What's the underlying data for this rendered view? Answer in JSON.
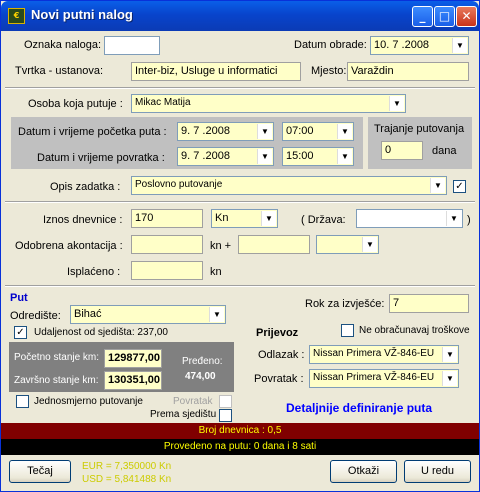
{
  "window": {
    "title": "Novi putni nalog",
    "icon_text": "€"
  },
  "labels": {
    "oznaka": "Oznaka naloga:",
    "datum_obrade": "Datum obrade:",
    "tvrtka": "Tvrtka - ustanova:",
    "mjesto": "Mjesto:",
    "osoba": "Osoba koja putuje :",
    "pocetak": "Datum i vrijeme početka puta :",
    "povratak": "Datum i vrijeme povratka :",
    "trajanje": "Trajanje putovanja",
    "dana": "dana",
    "opis": "Opis zadatka :",
    "iznos": "Iznos dnevnice :",
    "drzava_open": "( Država:",
    "drzava_close": ")",
    "akontacija": "Odobrena akontacija :",
    "kn_plus": "kn +",
    "isplaceno": "Isplaćeno :",
    "kn": "kn",
    "put": "Put",
    "odrediste": "Odredište:",
    "rok": "Rok za izvješće:",
    "udaljenost": "Udaljenost od sjedišta: 237,00",
    "pocetno_stanje": "Početno stanje km:",
    "zavrsno_stanje": "Završno stanje km:",
    "predjeno": "Pređeno:",
    "jednosmjerno": "Jednosmjerno putovanje",
    "povratak_chk": "Povratak",
    "prema_sjedistu": "Prema sjedištu",
    "prijevoz": "Prijevoz",
    "ne_obracunavaj": "Ne obračunavaj troškove",
    "odlazak": "Odlazak :",
    "povratak2": "Povratak :",
    "detaljnije": "Detaljnije definiranje puta"
  },
  "values": {
    "oznaka": "",
    "datum_obrade": "10. 7 .2008",
    "tvrtka": "Inter-biz, Usluge u informatici",
    "mjesto": "Varaždin",
    "osoba": "Mikac Matija",
    "pocetak_datum": "9. 7 .2008",
    "pocetak_vrijeme": "07:00",
    "povratak_datum": "9. 7 .2008",
    "povratak_vrijeme": "15:00",
    "trajanje": "0",
    "opis": "Poslovno putovanje",
    "iznos": "170",
    "valuta": "Kn",
    "drzava": "",
    "akontacija": "",
    "akontacija2": "",
    "akontacija_valuta": "",
    "isplaceno": "",
    "odrediste": "Bihać",
    "rok": "7",
    "pocetno_stanje": "129877,00",
    "zavrsno_stanje": "130351,00",
    "predjeno": "474,00",
    "odlazak": "Nissan Primera VŽ-846-EU",
    "povratak_vozilo": "Nissan Primera VŽ-846-EU"
  },
  "checkboxes": {
    "opis_chk": true,
    "udaljenost": true,
    "jednosmjerno": false,
    "povratak": false,
    "prema_sjedistu": false,
    "ne_obracunavaj": false
  },
  "status": {
    "broj_dnevnica": "Broj dnevnica : 0,5",
    "provedeno": "Provedeno na putu: 0 dana i 8 sati"
  },
  "footer": {
    "tecaj_label": "Tečaj",
    "eur": "EUR = 7,350000 Kn",
    "usd": "USD = 5,841488 Kn",
    "otkazi_label": "Otkaži",
    "uredu_label": "U redu"
  },
  "colors": {
    "input_bg": "#ffffc8",
    "status_red": "#800000",
    "status_black": "#000000",
    "status_text": "#ffff00",
    "link_blue": "#0000ff",
    "panel_gray": "#c0c0c0"
  }
}
